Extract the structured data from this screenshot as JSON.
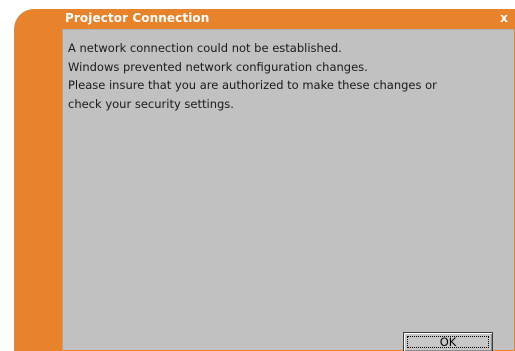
{
  "window": {
    "title": "Projector Connection",
    "close_label": "x"
  },
  "message": {
    "lines": [
      "A network connection could not be established.",
      "Windows prevented network configuration changes.",
      "Please insure that you are authorized to make these changes or",
      "check your security settings."
    ]
  },
  "buttons": {
    "ok_label": "OK"
  },
  "colors": {
    "accent": "#e8832b",
    "panel": "#c1c1c1"
  }
}
